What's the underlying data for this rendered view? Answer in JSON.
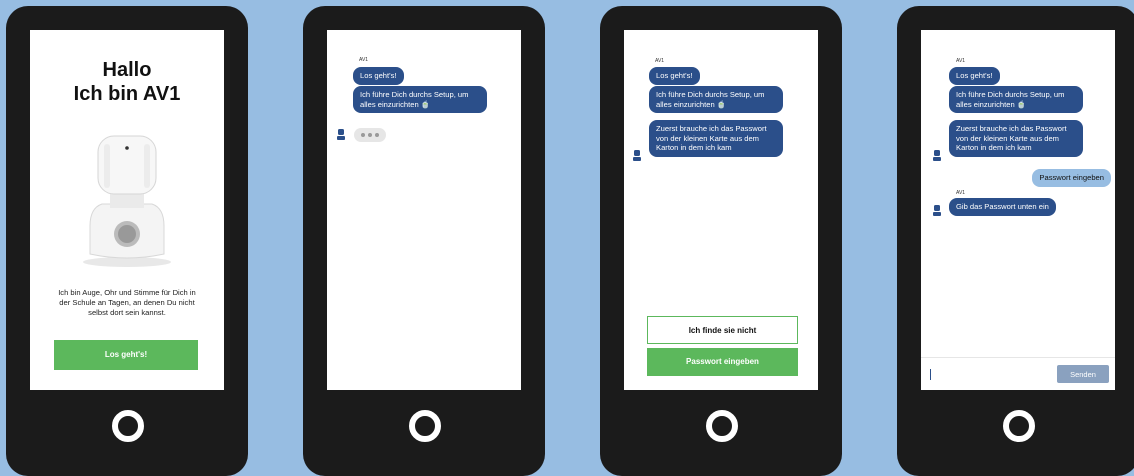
{
  "welcome": {
    "title_line1": "Hallo",
    "title_line2": "Ich bin AV1",
    "intro": "Ich bin Auge, Ohr und Stimme für Dich in der Schule an Tagen, an denen Du nicht selbst dort sein kannst.",
    "start_button": "Los geht's!"
  },
  "chat": {
    "sender": "AV1",
    "messages": {
      "lets_go": "Los geht's!",
      "setup": "Ich führe Dich durchs Setup, um alles einzurichten 🍵",
      "need_password": "Zuerst brauche ich das Passwort von der kleinen Karte aus dem Karton in dem ich kam",
      "user_enter_password": "Passwort eingeben",
      "enter_below": "Gib das Passwort unten ein"
    },
    "options": {
      "cant_find": "Ich finde sie nicht",
      "enter_password": "Passwort eingeben"
    },
    "send_button": "Senden"
  },
  "colors": {
    "background": "#97bde2",
    "phone": "#1b1b1b",
    "bot_bubble": "#2b4f8a",
    "user_bubble": "#97bde2",
    "accent_green": "#5cb85c"
  },
  "icons": [
    "robot-avatar-icon",
    "home-button-icon",
    "typing-indicator-icon"
  ]
}
